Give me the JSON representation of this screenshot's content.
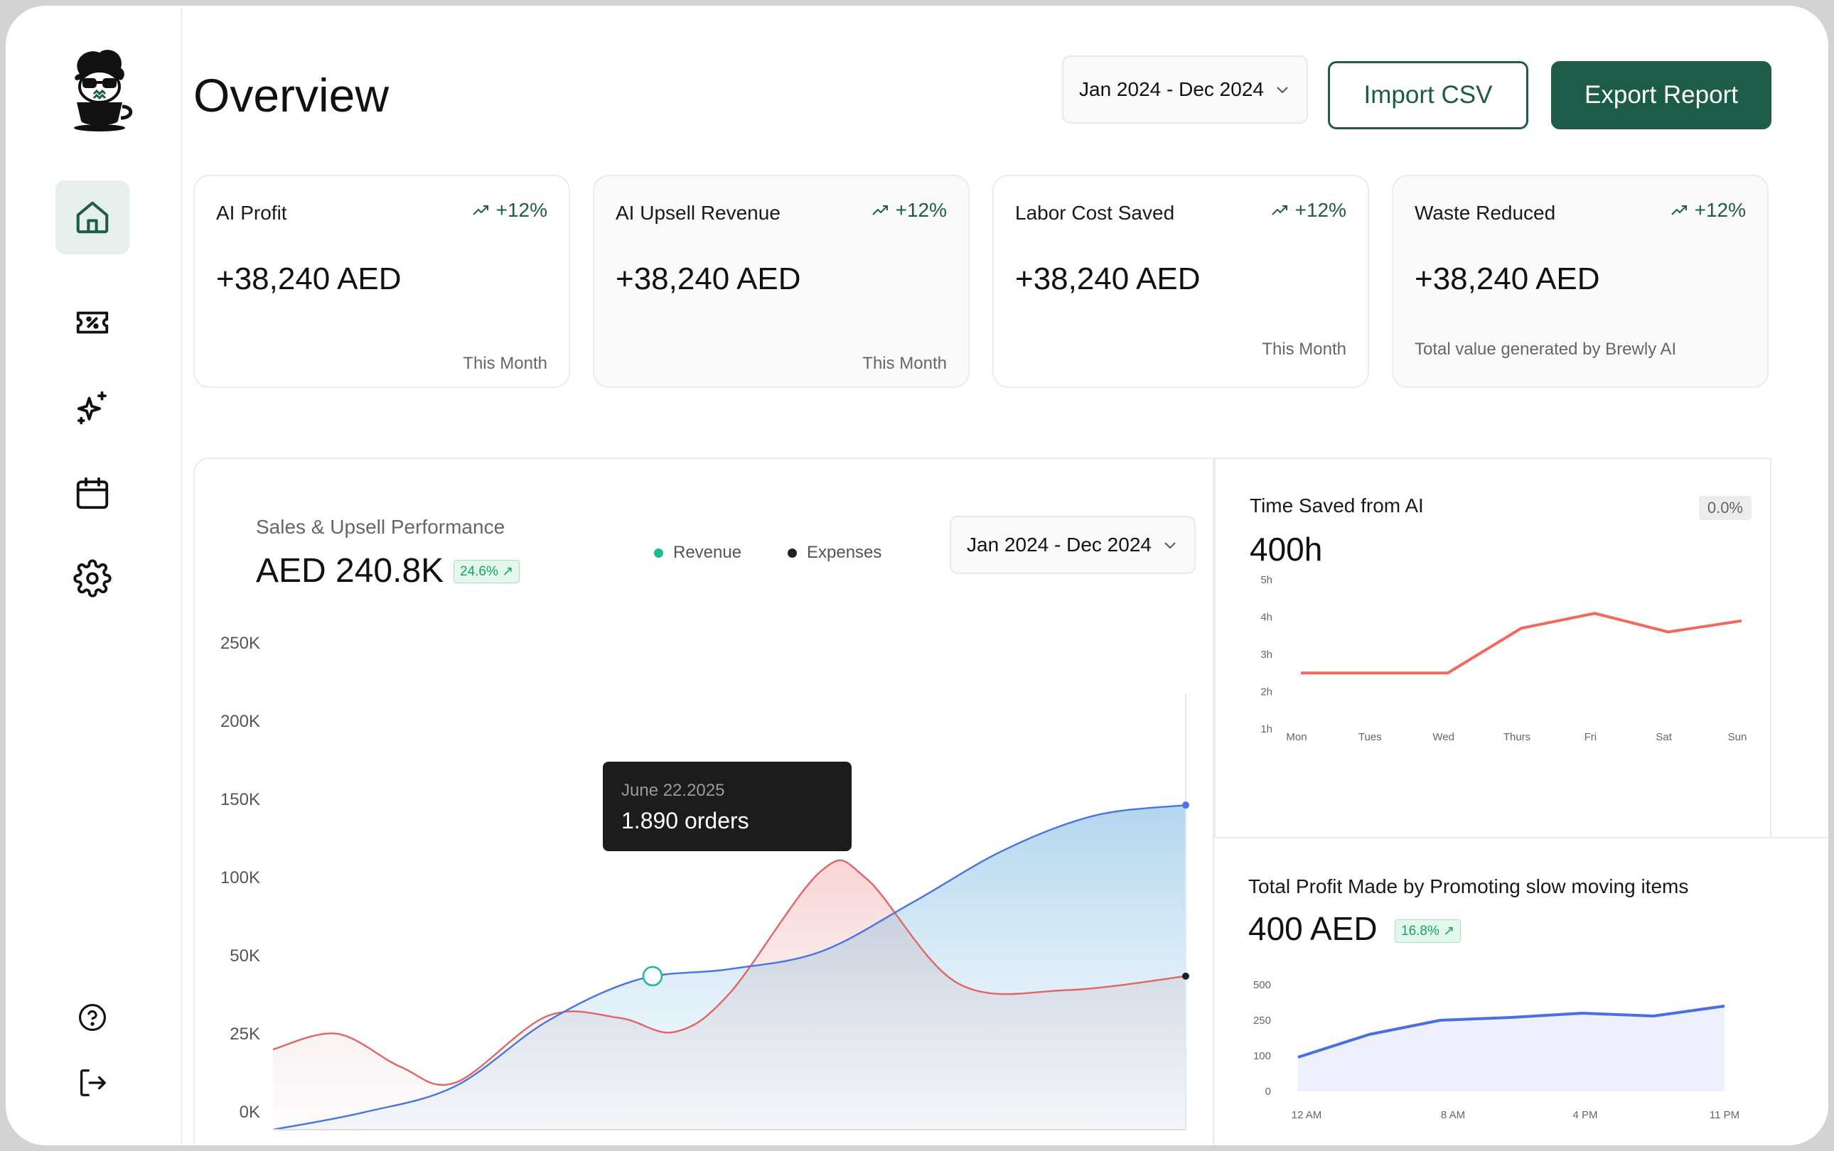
{
  "page": {
    "title": "Overview"
  },
  "header": {
    "date_range": "Jan 2024 - Dec 2024",
    "import_label": "Import CSV",
    "export_label": "Export Report"
  },
  "sidebar": {
    "items": [
      {
        "name": "home",
        "icon": "home-icon",
        "active": true
      },
      {
        "name": "coupons",
        "icon": "discount-ticket-icon",
        "active": false
      },
      {
        "name": "ai",
        "icon": "sparkles-icon",
        "active": false
      },
      {
        "name": "calendar",
        "icon": "calendar-icon",
        "active": false
      },
      {
        "name": "settings",
        "icon": "gear-icon",
        "active": false
      }
    ],
    "bottom": [
      {
        "name": "help",
        "icon": "help-circle-icon"
      },
      {
        "name": "logout",
        "icon": "logout-icon"
      }
    ]
  },
  "kpis": [
    {
      "label": "AI Profit",
      "change": "+12%",
      "value": "+38,240 AED",
      "note": "This Month"
    },
    {
      "label": "AI Upsell Revenue",
      "change": "+12%",
      "value": "+38,240 AED",
      "note": "This Month"
    },
    {
      "label": "Labor Cost Saved",
      "change": "+12%",
      "value": "+38,240 AED",
      "note": "This Month"
    },
    {
      "label": "Waste Reduced",
      "change": "+12%",
      "value": "+38,240 AED",
      "note": "Total value generated by Brewly AI"
    }
  ],
  "sales": {
    "subtitle": "Sales & Upsell Performance",
    "value": "AED 240.8K",
    "badge": "24.6% ↗",
    "legend": [
      "Revenue",
      "Expenses"
    ],
    "date_range": "Jan 2024 - Dec 2024",
    "tooltip": {
      "date": "June 22.2025",
      "value": "1.890 orders"
    }
  },
  "time_saved": {
    "title": "Time Saved from AI",
    "badge": "0.0%",
    "value": "400h"
  },
  "profit": {
    "title": "Total Profit Made by Promoting slow moving items",
    "value": "400 AED",
    "badge": "16.8% ↗"
  },
  "colors": {
    "brand": "#1d5c49",
    "revenue_line": "#4a74e0",
    "expense_line": "#e06666",
    "time_line": "#f06a5f",
    "profit_line": "#4a6fe3",
    "legend_revenue": "#1fb894",
    "legend_expense": "#222222"
  },
  "chart_data": [
    {
      "type": "area",
      "title": "Sales & Upsell Performance",
      "y_ticks": [
        "0K",
        "25K",
        "50K",
        "100K",
        "150K",
        "200K",
        "250K"
      ],
      "ylim": [
        0,
        250000
      ],
      "series": [
        {
          "name": "Revenue",
          "x": [
            0,
            0.1,
            0.2,
            0.3,
            0.4,
            0.5,
            0.6,
            0.7,
            0.8,
            0.9,
            1.0
          ],
          "values": [
            0,
            10000,
            25000,
            62000,
            86000,
            92000,
            102000,
            130000,
            160000,
            180000,
            186000
          ]
        },
        {
          "name": "Expenses",
          "x": [
            0,
            0.07,
            0.14,
            0.2,
            0.3,
            0.38,
            0.44,
            0.5,
            0.6,
            0.65,
            0.75,
            0.87,
            1.0
          ],
          "values": [
            46000,
            55000,
            36000,
            27000,
            65000,
            64000,
            56000,
            78000,
            148000,
            144000,
            84000,
            80000,
            88000
          ]
        }
      ],
      "grid": false,
      "legend": "top"
    },
    {
      "type": "line",
      "title": "Time Saved from AI",
      "categories": [
        "Mon",
        "Tues",
        "Wed",
        "Thurs",
        "Fri",
        "Sat",
        "Sun"
      ],
      "y_ticks": [
        "1h",
        "2h",
        "3h",
        "4h",
        "5h"
      ],
      "ylim": [
        1,
        5
      ],
      "series": [
        {
          "values": [
            2.5,
            2.5,
            2.5,
            3.7,
            4.1,
            3.6,
            3.9
          ]
        }
      ],
      "grid": false
    },
    {
      "type": "area",
      "title": "Total Profit Made by Promoting slow moving items",
      "categories": [
        "12 AM",
        "8 AM",
        "4 PM",
        "11 PM"
      ],
      "y_ticks": [
        "0",
        "100",
        "250",
        "500"
      ],
      "series": [
        {
          "values": [
            120,
            200,
            250,
            260,
            275,
            265,
            300
          ]
        }
      ],
      "grid": false
    }
  ]
}
